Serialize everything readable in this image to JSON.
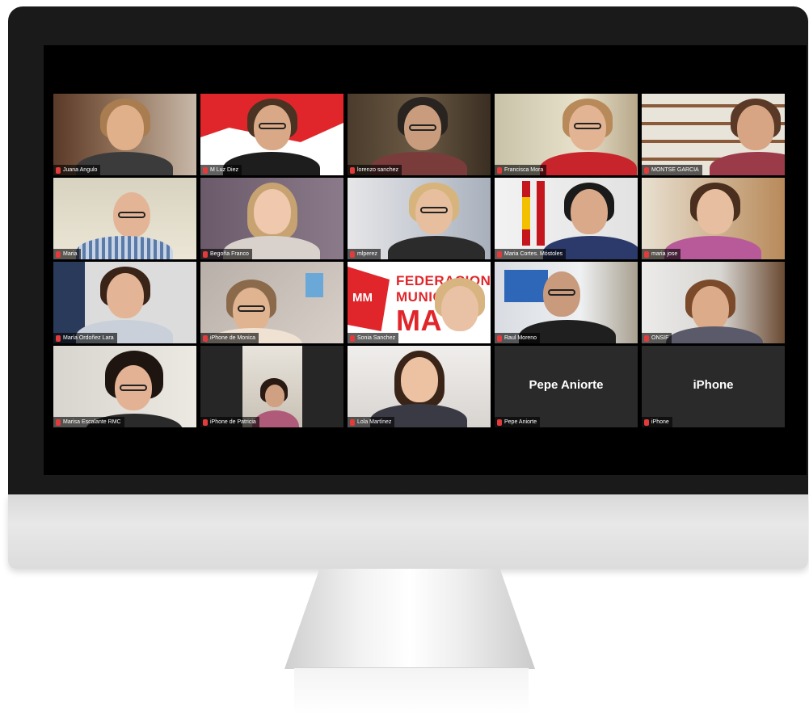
{
  "meeting": {
    "participants": [
      {
        "name": "Juana Angulo"
      },
      {
        "name": "M Luz Diez"
      },
      {
        "name": "lorenzo sanchez"
      },
      {
        "name": "Francisca Mora"
      },
      {
        "name": "MONTSE GARCIA"
      },
      {
        "name": "Maria"
      },
      {
        "name": "Begoña Franco"
      },
      {
        "name": "mlperez"
      },
      {
        "name": "Maria Cortes. Móstoles"
      },
      {
        "name": "maria jose"
      },
      {
        "name": "María Ordoñez Lara"
      },
      {
        "name": "iPhone de Monica"
      },
      {
        "name": "Sonia Sanchez"
      },
      {
        "name": "Raul Moreno"
      },
      {
        "name": "ONSIF"
      },
      {
        "name": "Marisa Escalante RMC"
      },
      {
        "name": "iPhone de Patricia"
      },
      {
        "name": "Lola Martínez"
      },
      {
        "name": "Pepe Aniorte",
        "display": "Pepe Aniorte"
      },
      {
        "name": "iPhone",
        "display": "iPhone"
      }
    ],
    "banner": {
      "logo": "MM",
      "line1": "FEDERACION",
      "line2": "MUNICIPIOS",
      "line3": "MA"
    }
  },
  "icons": {
    "mute": "muted-microphone-icon"
  },
  "colors": {
    "accent_active": "#e8d34a",
    "mute_red": "#e23b3b",
    "fmm_red": "#e0262b"
  }
}
